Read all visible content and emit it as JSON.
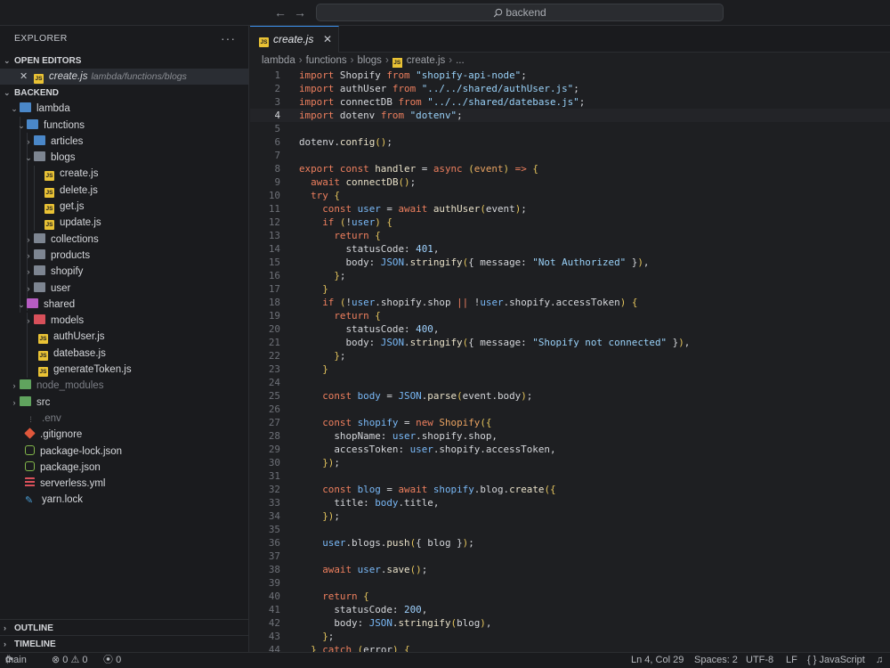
{
  "titlebar": {
    "back": "←",
    "forward": "→",
    "search": "backend"
  },
  "explorer": {
    "title": "EXPLORER",
    "more": "···",
    "open_editors_label": "OPEN EDITORS",
    "open_file": "create.js",
    "open_file_path": "lambda/functions/blogs",
    "project_label": "BACKEND",
    "tree": [
      {
        "label": "lambda"
      },
      {
        "label": "functions"
      },
      {
        "label": "articles"
      },
      {
        "label": "blogs"
      },
      {
        "label": "create.js"
      },
      {
        "label": "delete.js"
      },
      {
        "label": "get.js"
      },
      {
        "label": "update.js"
      },
      {
        "label": "collections"
      },
      {
        "label": "products"
      },
      {
        "label": "shopify"
      },
      {
        "label": "user"
      },
      {
        "label": "shared"
      },
      {
        "label": "models"
      },
      {
        "label": "authUser.js"
      },
      {
        "label": "datebase.js"
      },
      {
        "label": "generateToken.js"
      },
      {
        "label": "node_modules"
      },
      {
        "label": "src"
      },
      {
        "label": ".env"
      },
      {
        "label": ".gitignore"
      },
      {
        "label": "package-lock.json"
      },
      {
        "label": "package.json"
      },
      {
        "label": "serverless.yml"
      },
      {
        "label": "yarn.lock"
      }
    ],
    "outline_label": "OUTLINE",
    "timeline_label": "TIMELINE"
  },
  "editor": {
    "tab_label": "create.js",
    "breadcrumbs": [
      "lambda",
      "functions",
      "blogs",
      "create.js",
      "..."
    ],
    "current_line": 4
  },
  "statusbar": {
    "branch": "main",
    "errors": "0",
    "warnings": "0",
    "ports": "0",
    "position": "Ln 4, Col 29",
    "spaces": "Spaces: 2",
    "encoding": "UTF-8",
    "eol": "LF",
    "language": "JavaScript",
    "lang_icon": "{ }"
  }
}
